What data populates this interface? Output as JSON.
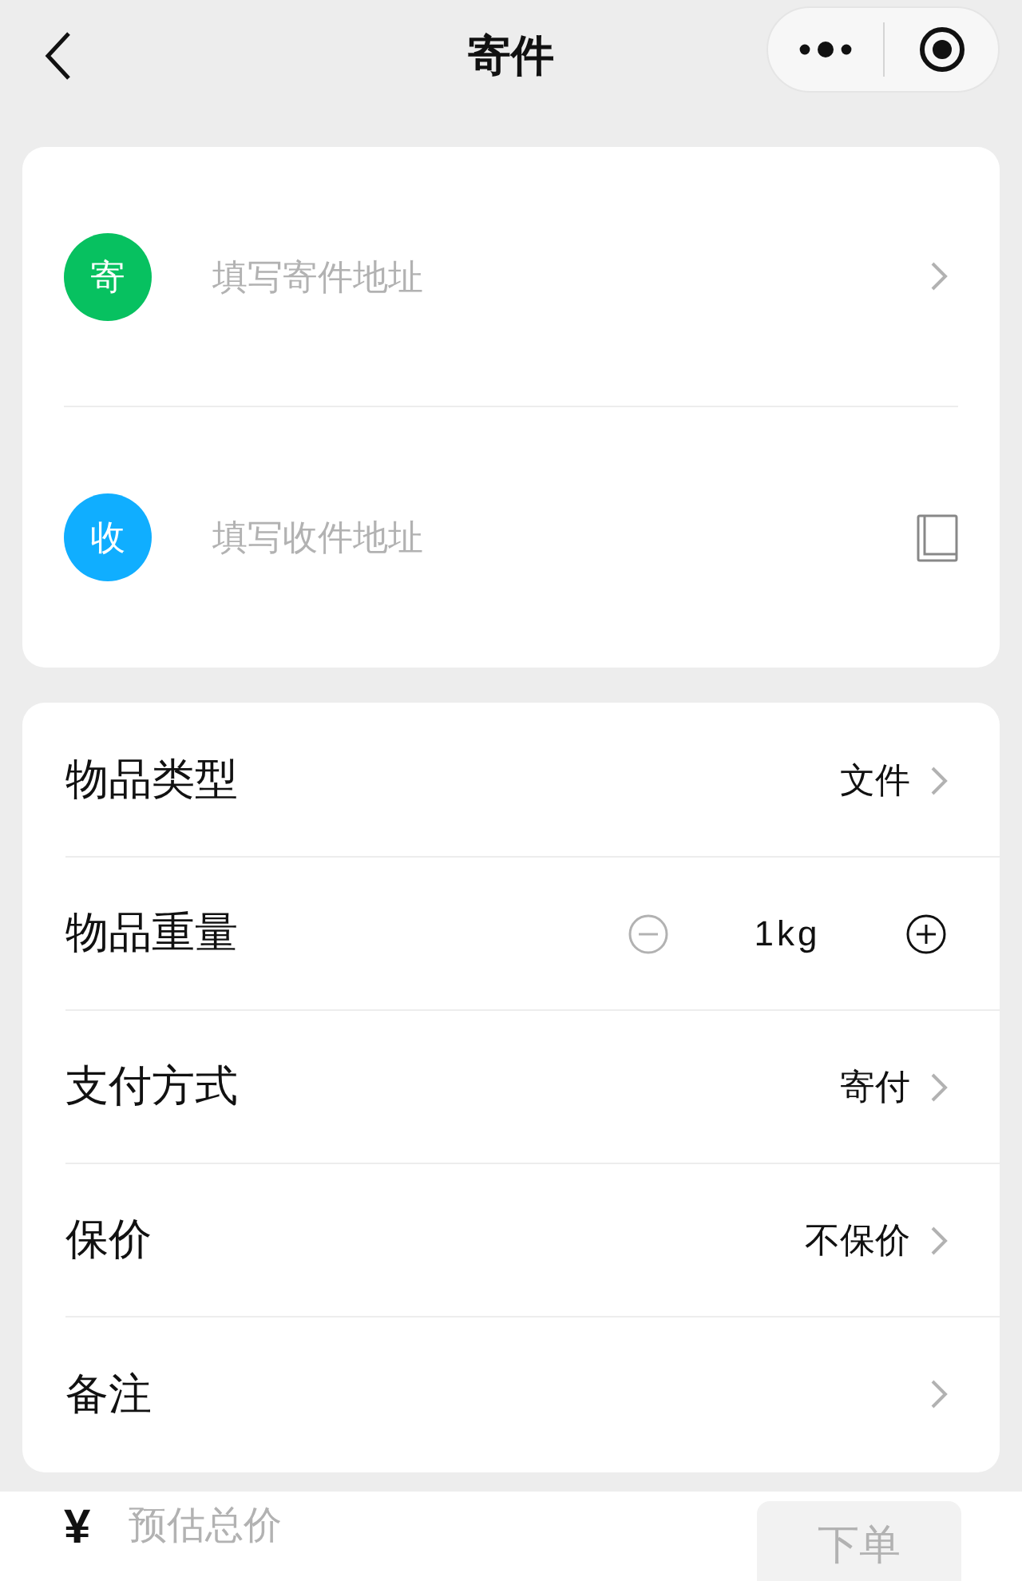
{
  "nav": {
    "title": "寄件"
  },
  "addresses": [
    {
      "badge": "寄",
      "color": "#07c160",
      "placeholder": "填写寄件地址",
      "kind": "arrow"
    },
    {
      "badge": "收",
      "color": "#10aeff",
      "placeholder": "填写收件地址",
      "kind": "book"
    }
  ],
  "options": [
    {
      "kind": "select",
      "label": "物品类型",
      "value": "文件"
    },
    {
      "kind": "stepper",
      "label": "物品重量",
      "value": "1kg",
      "minus_disabled": true
    },
    {
      "kind": "select",
      "label": "支付方式",
      "value": "寄付"
    },
    {
      "kind": "select",
      "label": "保价",
      "value": "不保价"
    },
    {
      "kind": "select",
      "label": "备注"
    }
  ],
  "footer": {
    "currency": "¥",
    "total_label": "预估总价",
    "submit": "下单"
  }
}
